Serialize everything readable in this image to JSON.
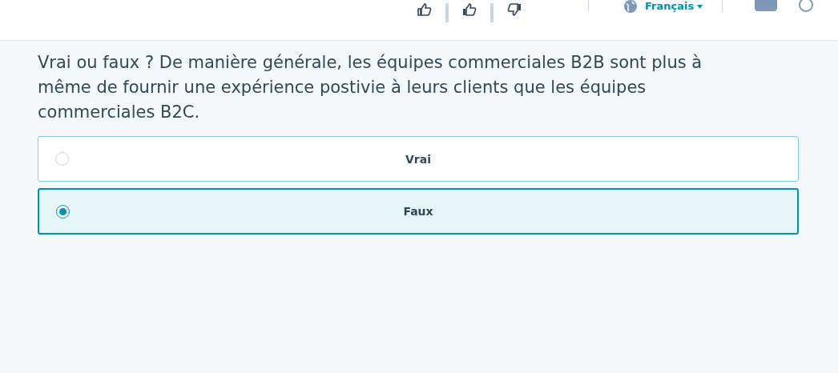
{
  "top_bar": {
    "language": "Français"
  },
  "question": "Vrai ou faux ? De manière générale, les équipes commerciales B2B sont plus à même de fournir une expérience postivie à leurs clients que les équipes commerciales B2C.",
  "options": [
    {
      "label": "Vrai",
      "selected": false
    },
    {
      "label": "Faux",
      "selected": true
    }
  ]
}
